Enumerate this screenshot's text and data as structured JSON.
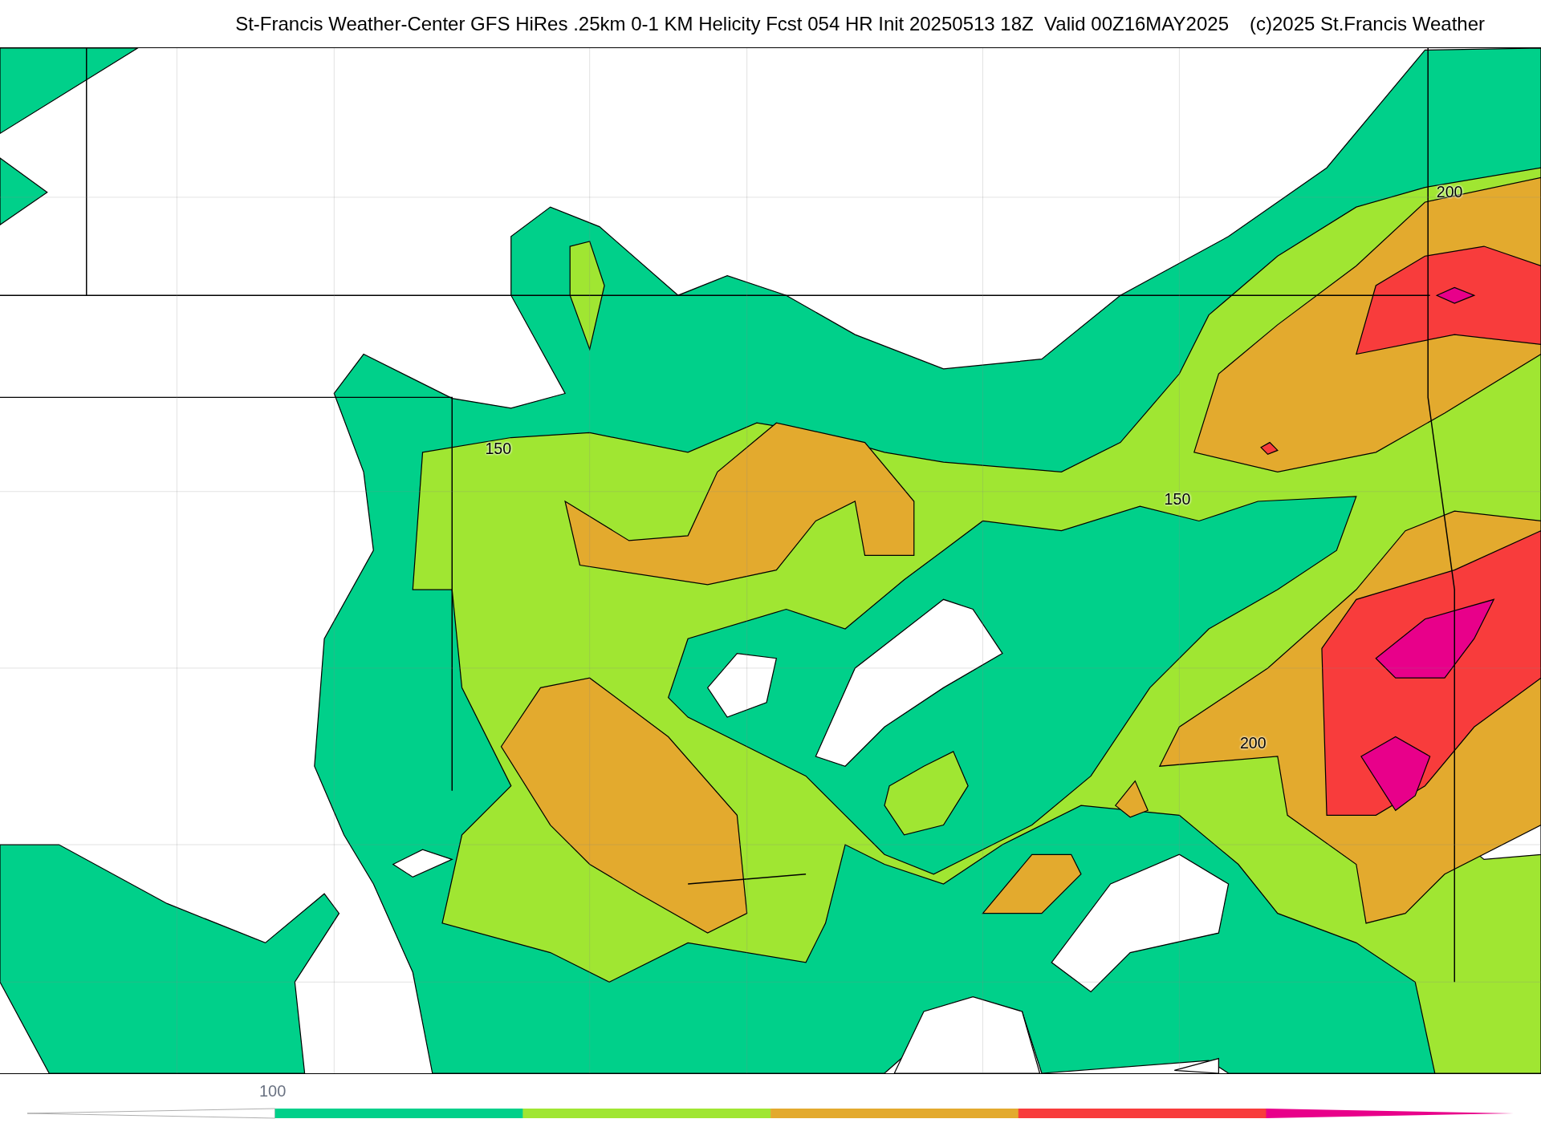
{
  "header": {
    "title": "St-Francis Weather-Center GFS HiRes .25km 0-1 KM Helicity Fcst 054 HR Init 20250513 18Z  Valid 00Z16MAY2025",
    "credit": "(c)2025 St.Francis Weather"
  },
  "map": {
    "contour_labels": [
      {
        "text": "150",
        "kind": "left"
      },
      {
        "text": "150",
        "kind": "center"
      },
      {
        "text": "200",
        "kind": "top"
      },
      {
        "text": "200",
        "kind": "bottom"
      }
    ]
  },
  "colorbar": {
    "tick_label": "100",
    "bins": [
      {
        "kind": "low_end",
        "color": "#ffffff"
      },
      {
        "kind": "band",
        "color": "#00d08a"
      },
      {
        "kind": "band",
        "color": "#a0e632"
      },
      {
        "kind": "band",
        "color": "#e3aa2e"
      },
      {
        "kind": "band",
        "color": "#f83c3c"
      },
      {
        "kind": "high_end",
        "color": "#e8008a"
      }
    ]
  }
}
